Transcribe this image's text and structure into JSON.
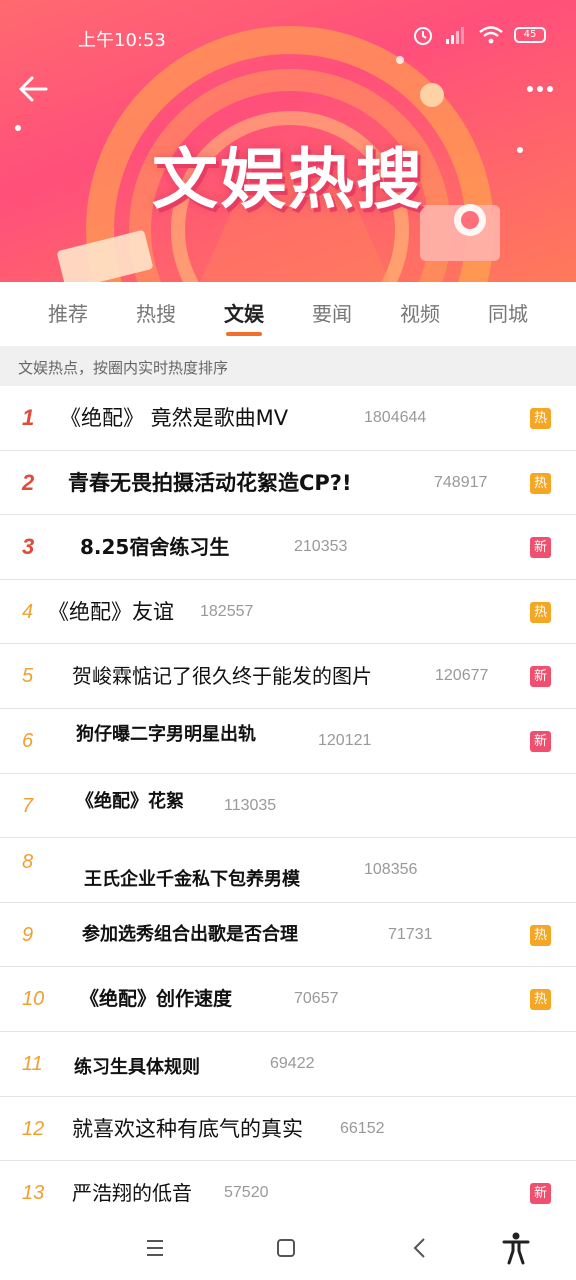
{
  "status_bar": {
    "time": "上午10:53",
    "battery": "45"
  },
  "banner": {
    "title": "文娱热搜"
  },
  "tabs": [
    {
      "label": "推荐",
      "active": false
    },
    {
      "label": "热搜",
      "active": false
    },
    {
      "label": "文娱",
      "active": true
    },
    {
      "label": "要闻",
      "active": false
    },
    {
      "label": "视频",
      "active": false
    },
    {
      "label": "同城",
      "active": false
    }
  ],
  "subtitle": "文娱热点，按圈内实时热度排序",
  "items": [
    {
      "rank": "1",
      "title": "《绝配》 竟然是歌曲MV",
      "count": "1804644",
      "badge": "热"
    },
    {
      "rank": "2",
      "title": "青春无畏拍摄活动花絮造CP?!",
      "count": "748917",
      "badge": "热"
    },
    {
      "rank": "3",
      "title": "8.25宿舍练习生",
      "count": "210353",
      "badge": "新"
    },
    {
      "rank": "4",
      "title": "《绝配》友谊",
      "count": "182557",
      "badge": "热"
    },
    {
      "rank": "5",
      "title": "贺峻霖惦记了很久终于能发的图片",
      "count": "120677",
      "badge": "新"
    },
    {
      "rank": "6",
      "title": "狗仔曝二字男明星出轨",
      "count": "120121",
      "badge": "新"
    },
    {
      "rank": "7",
      "title": "《绝配》花絮",
      "count": "113035",
      "badge": ""
    },
    {
      "rank": "8",
      "title": "王氏企业千金私下包养男模",
      "count": "108356",
      "badge": ""
    },
    {
      "rank": "9",
      "title": "参加选秀组合出歌是否合理",
      "count": "71731",
      "badge": "热"
    },
    {
      "rank": "10",
      "title": "《绝配》创作速度",
      "count": "70657",
      "badge": "热"
    },
    {
      "rank": "11",
      "title": "练习生具体规则",
      "count": "69422",
      "badge": ""
    },
    {
      "rank": "12",
      "title": "就喜欢这种有底气的真实",
      "count": "66152",
      "badge": ""
    },
    {
      "rank": "13",
      "title": "严浩翔的低音",
      "count": "57520",
      "badge": "新"
    }
  ],
  "colors": {
    "accent": "#f36e2c",
    "rank_top": "#e04b3a",
    "rank_other": "#f0a030",
    "badge_hot": "#f5a623",
    "badge_new": "#f0506e"
  },
  "icons": [
    "back-arrow-icon",
    "more-icon",
    "alarm-icon",
    "signal-icon",
    "wifi-icon",
    "battery-icon",
    "menu-icon",
    "home-square-icon",
    "back-chevron-icon",
    "accessibility-icon"
  ]
}
